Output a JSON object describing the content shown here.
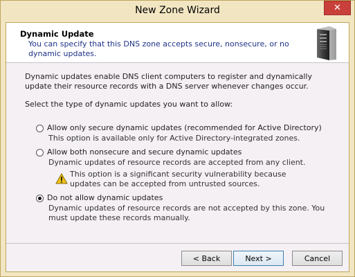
{
  "window": {
    "title": "New Zone Wizard",
    "close_glyph": "✕"
  },
  "header": {
    "title": "Dynamic Update",
    "subtitle": "You can specify that this DNS zone accepts secure, nonsecure, or no dynamic updates.",
    "icon": "server-icon"
  },
  "body": {
    "intro": "Dynamic updates enable DNS client computers to register and dynamically update their resource records with a DNS server whenever changes occur.",
    "prompt": "Select the type of dynamic updates you want to allow:"
  },
  "options": [
    {
      "label": "Allow only secure dynamic updates (recommended for Active Directory)",
      "description": "This option is available only for Active Directory-integrated zones.",
      "selected": false
    },
    {
      "label": "Allow both nonsecure and secure dynamic updates",
      "description": "Dynamic updates of resource records are accepted from any client.",
      "warning": "This option is a significant security vulnerability because updates can be accepted from untrusted sources.",
      "selected": false
    },
    {
      "label": "Do not allow dynamic updates",
      "description": "Dynamic updates of resource records are not accepted by this zone. You must update these records manually.",
      "selected": true
    }
  ],
  "buttons": {
    "back": "< Back",
    "next": "Next >",
    "cancel": "Cancel"
  },
  "colors": {
    "frame": "#f2e6c2",
    "client": "#f4f0f4",
    "subtitle": "#1e3287",
    "close": "#c9403a",
    "warning": "#f0c419"
  }
}
